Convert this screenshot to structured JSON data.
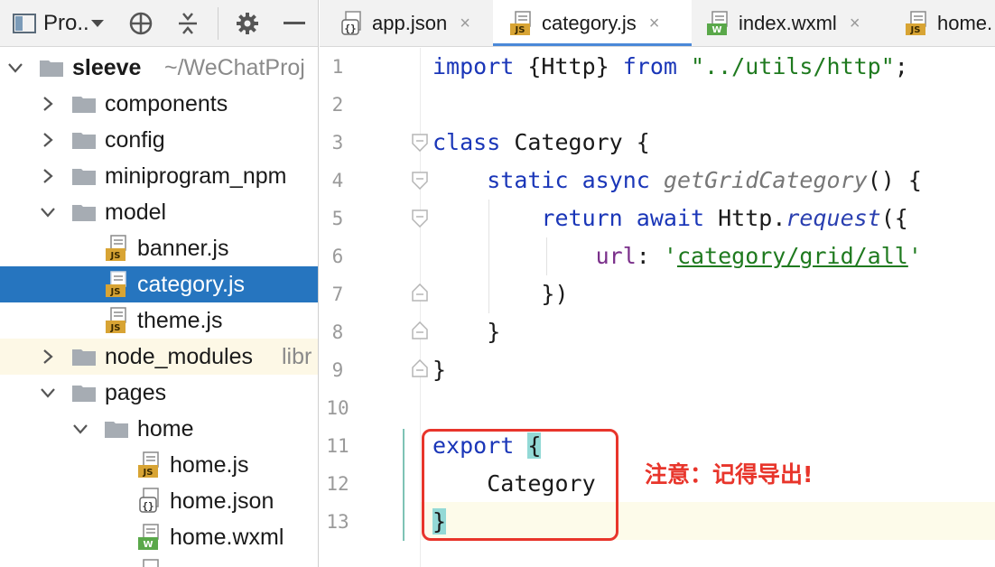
{
  "project_panel": {
    "toolbar": {
      "title": "Pro..",
      "icons": [
        "project-view-icon",
        "dropdown-caret-icon",
        "locate-target-icon",
        "collapse-all-icon",
        "gear-icon",
        "minimize-icon"
      ]
    },
    "tree": [
      {
        "label": "sleeve",
        "hint": "~/WeChatProj",
        "kind": "folder",
        "expanded": true
      },
      {
        "label": "components",
        "kind": "folder",
        "expanded": false
      },
      {
        "label": "config",
        "kind": "folder",
        "expanded": false
      },
      {
        "label": "miniprogram_npm",
        "kind": "folder",
        "expanded": false
      },
      {
        "label": "model",
        "kind": "folder",
        "expanded": true
      },
      {
        "label": "banner.js",
        "kind": "js",
        "icon_text": "JS"
      },
      {
        "label": "category.js",
        "kind": "js",
        "icon_text": "JS",
        "selected": true
      },
      {
        "label": "theme.js",
        "kind": "js",
        "icon_text": "JS"
      },
      {
        "label": "node_modules",
        "hint": "libr",
        "kind": "folder",
        "expanded": false
      },
      {
        "label": "pages",
        "kind": "folder",
        "expanded": true
      },
      {
        "label": "home",
        "kind": "folder",
        "expanded": true
      },
      {
        "label": "home.js",
        "kind": "js",
        "icon_text": "JS"
      },
      {
        "label": "home.json",
        "kind": "json",
        "icon_text": "{}"
      },
      {
        "label": "home.wxml",
        "kind": "wxml",
        "icon_text": "W"
      }
    ]
  },
  "tabs": [
    {
      "label": "app.json",
      "icon": "json-file-icon",
      "icon_text": "{}",
      "active": false,
      "close": "×"
    },
    {
      "label": "category.js",
      "icon": "js-file-icon",
      "icon_text": "JS",
      "active": true,
      "close": "×"
    },
    {
      "label": "index.wxml",
      "icon": "wxml-file-icon",
      "icon_text": "W",
      "active": false,
      "close": "×"
    },
    {
      "label": "home.",
      "icon": "js-file-icon",
      "icon_text": "JS",
      "active": false,
      "close": ""
    }
  ],
  "editor": {
    "line_numbers": [
      "1",
      "2",
      "3",
      "4",
      "5",
      "6",
      "7",
      "8",
      "9",
      "10",
      "11",
      "12",
      "13"
    ],
    "code": {
      "l1": {
        "import": "import",
        "body": " {Http} ",
        "from": "from",
        "path": "\"../utils/http\"",
        "semi": ";"
      },
      "l3": {
        "kw": "class",
        "rest": " Category {"
      },
      "l4": {
        "static": "static",
        "async": "async",
        "fn": "getGridCategory",
        "rest": "() {"
      },
      "l5": {
        "ret": "return",
        "await": "await",
        "obj": " Http.",
        "meth": "request",
        "rest": "({"
      },
      "l6": {
        "key": "url",
        "colon": ": ",
        "q1": "'",
        "value": "category/grid/all",
        "q2": "'"
      },
      "l7": {
        "text": "})"
      },
      "l8": {
        "text": "}"
      },
      "l9": {
        "text": "}"
      },
      "l11": {
        "kw": "export",
        "brace": "{"
      },
      "l12": {
        "text": "Category"
      },
      "l13": {
        "brace": "}"
      }
    },
    "annotation": "注意：记得导出!",
    "colors": {
      "keyword": "#1a36b8",
      "string": "#1f7a1f",
      "annotation": "#e8352b",
      "selection": "#2675bf",
      "brace_match": "#93d9d6"
    }
  }
}
